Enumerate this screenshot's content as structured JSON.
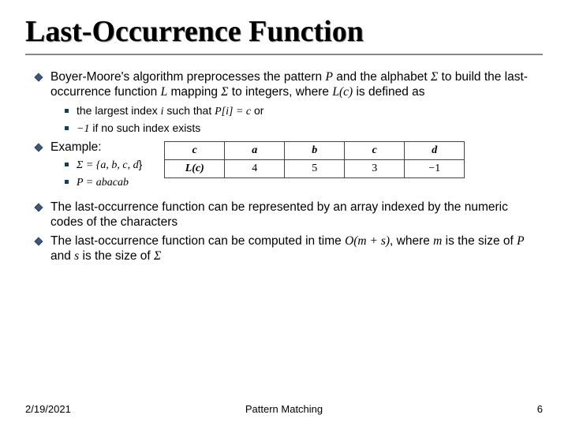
{
  "title": "Last-Occurrence Function",
  "bullets": {
    "p1a": "Boyer-Moore's algorithm preprocesses the pattern ",
    "p1b": " and the alphabet ",
    "p1c": " to build the last-occurrence function ",
    "p1d": " mapping ",
    "p1e": " to integers, where ",
    "p1f": " is defined as",
    "s1a": "the largest index ",
    "s1b": " such that ",
    "s1c": " or",
    "s2a": " if no such index exists",
    "p2": "Example:",
    "s3pre": "Σ = {",
    "s3body": "a, b, c, d",
    "s3post": "}",
    "s4pre": "P = ",
    "s4body": "abacab",
    "p3": "The last-occurrence function can be represented by an array indexed by the numeric codes of the characters",
    "p4a": "The last-occurrence function can be computed in time ",
    "p4b": ", where ",
    "p4c": " is the size of ",
    "p4d": " and ",
    "p4e": " is the size of "
  },
  "sym": {
    "P": "P",
    "Sigma": "Σ",
    "L": "L",
    "Lc": "L(c)",
    "i": "i",
    "Pi_eq_c": "P[i] = c",
    "neg1": "−1",
    "Oms": "O(m + s)",
    "m": "m",
    "s": "s",
    "c": "c"
  },
  "table": {
    "h0": "c",
    "h1": "a",
    "h2": "b",
    "h3": "c",
    "h4": "d",
    "r0": "L(c)",
    "r1": "4",
    "r2": "5",
    "r3": "3",
    "r4": "−1"
  },
  "footer": {
    "date": "2/19/2021",
    "topic": "Pattern Matching",
    "page": "6"
  }
}
